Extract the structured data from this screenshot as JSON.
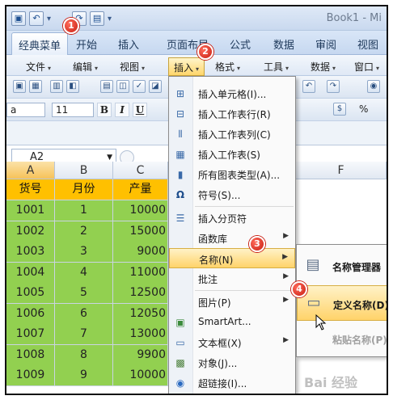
{
  "titlebar": {
    "title": "Book1 - Mi"
  },
  "ribbon_tabs": [
    "经典菜单",
    "开始",
    "插入",
    "页面布局",
    "公式",
    "数据",
    "审阅",
    "视图"
  ],
  "menubar": [
    "文件",
    "编辑",
    "视图",
    "插入",
    "格式",
    "工具",
    "数据",
    "窗口"
  ],
  "toolbar": {
    "font_name": "a",
    "font_size": "11",
    "bold": "B",
    "italic": "I",
    "underline": "U",
    "percent": "%"
  },
  "formula_bar": {
    "cell_ref": "A2"
  },
  "columns": [
    "A",
    "B",
    "C",
    "F"
  ],
  "headers": [
    "货号",
    "月份",
    "产量"
  ],
  "rows": [
    [
      "1001",
      "1",
      "10000"
    ],
    [
      "1002",
      "2",
      "15000"
    ],
    [
      "1003",
      "3",
      "9000"
    ],
    [
      "1004",
      "4",
      "11000"
    ],
    [
      "1005",
      "5",
      "12500"
    ],
    [
      "1006",
      "6",
      "12050"
    ],
    [
      "1007",
      "7",
      "13000"
    ],
    [
      "1008",
      "8",
      "9900"
    ],
    [
      "1009",
      "9",
      "10000"
    ]
  ],
  "insert_menu": [
    {
      "label": "插入单元格(I)...",
      "icon": "insert-cells-icon"
    },
    {
      "label": "插入工作表行(R)",
      "icon": "insert-row-icon"
    },
    {
      "label": "插入工作表列(C)",
      "icon": "insert-column-icon"
    },
    {
      "label": "插入工作表(S)",
      "icon": "insert-sheet-icon"
    },
    {
      "label": "所有图表类型(A)...",
      "icon": "chart-icon"
    },
    {
      "label": "符号(S)...",
      "icon": "omega-icon"
    },
    {
      "label": "插入分页符",
      "icon": "page-break-icon"
    },
    {
      "label": "函数库",
      "icon": ""
    },
    {
      "label": "名称(N)",
      "icon": ""
    },
    {
      "label": "批注",
      "icon": ""
    },
    {
      "label": "图片(P)",
      "icon": ""
    },
    {
      "label": "SmartArt...",
      "icon": "smartart-icon"
    },
    {
      "label": "文本框(X)",
      "icon": "textbox-icon"
    },
    {
      "label": "对象(J)...",
      "icon": "object-icon"
    },
    {
      "label": "超链接(I)...",
      "icon": "hyperlink-icon"
    }
  ],
  "name_submenu": [
    {
      "label": "名称管理器",
      "icon": "name-manager-icon"
    },
    {
      "label": "定义名称(D)",
      "icon": "define-name-icon"
    },
    {
      "label": "粘贴名称(P)...",
      "icon": ""
    }
  ],
  "badges": [
    "1",
    "2",
    "3",
    "4"
  ],
  "colors": {
    "header_fill": "#ffc000",
    "data_fill": "#92d050",
    "highlight": "#ffd36a",
    "badge": "#c81e12"
  }
}
